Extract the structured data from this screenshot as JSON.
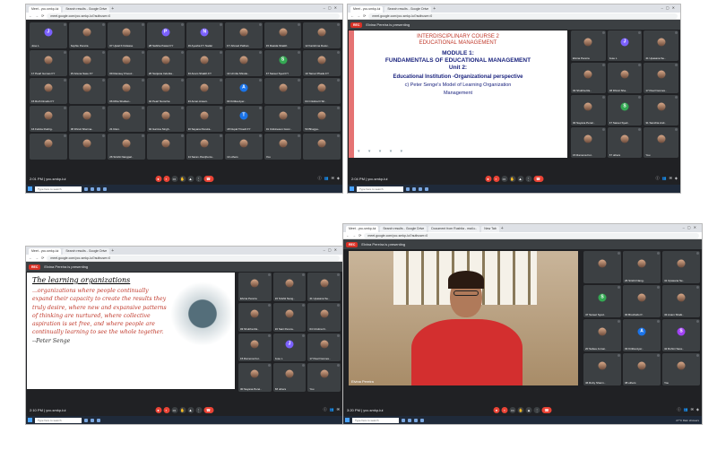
{
  "shot1": {
    "tabs": [
      "Meet - ycc-smkp-lui",
      "Search results - Google Drive"
    ],
    "url": "meet.google.com/ycc-smkp-lui?authuser=0",
    "participants": [
      {
        "name": "Jose L",
        "initial": "J",
        "color": "#7b61ff"
      },
      {
        "name": "Sophie Pereira",
        "initial": "",
        "color": ""
      },
      {
        "name": "07 Ujwal K Dolasse",
        "initial": "",
        "color": ""
      },
      {
        "name": "28 Sabiha Pawar FY",
        "initial": "P",
        "color": "#7b61ff"
      },
      {
        "name": "29 Ayesha FY Nadar",
        "initial": "N",
        "color": "#7b61ff"
      },
      {
        "name": "FY Ahmed Pathan",
        "initial": "",
        "color": ""
      },
      {
        "name": "15 Rasida Shaikh",
        "initial": "",
        "color": ""
      },
      {
        "name": "12 Karishma Desiv..",
        "initial": "",
        "color": ""
      },
      {
        "name": "17 Pearl Gomes FY",
        "initial": "",
        "color": ""
      },
      {
        "name": "15 Ariena Saxe FY",
        "initial": "",
        "color": ""
      },
      {
        "name": "09 Ramsey D'souz..",
        "initial": "",
        "color": ""
      },
      {
        "name": "26 Sanjana Indurka..",
        "initial": "",
        "color": ""
      },
      {
        "name": "43 Anam Shaikh FY",
        "initial": "",
        "color": ""
      },
      {
        "name": "14 Urmila Shinde..",
        "initial": "",
        "color": ""
      },
      {
        "name": "47 Sareet Syed FY",
        "initial": "S",
        "color": "#34a853"
      },
      {
        "name": "10 Tamar Phade FY",
        "initial": "",
        "color": ""
      },
      {
        "name": "15 Ruth Dmello FY",
        "initial": "",
        "color": ""
      },
      {
        "name": "",
        "initial": "",
        "color": ""
      },
      {
        "name": "06 Riha Shelken..",
        "initial": "",
        "color": ""
      },
      {
        "name": "42 Pearl Noronha",
        "initial": "",
        "color": ""
      },
      {
        "name": "33 Aman Ansari..",
        "initial": "",
        "color": ""
      },
      {
        "name": "03 Kritika Ayer..",
        "initial": "A",
        "color": "#1a73e8"
      },
      {
        "name": "",
        "initial": "",
        "color": ""
      },
      {
        "name": "04 Cristina D Sil..",
        "initial": "",
        "color": ""
      },
      {
        "name": "16 Felicia Rodrig..",
        "initial": "",
        "color": ""
      },
      {
        "name": "08 Dhruti Sharma..",
        "initial": "",
        "color": ""
      },
      {
        "name": "21 Ravi..",
        "initial": "",
        "color": ""
      },
      {
        "name": "02 Garima Singh..",
        "initial": "",
        "color": ""
      },
      {
        "name": "30 Sayana Pereira..",
        "initial": "",
        "color": ""
      },
      {
        "name": "18 Nupal Trivedi FY",
        "initial": "T",
        "color": "#1a73e8"
      },
      {
        "name": "01 Cidvineson Gonc..",
        "initial": "",
        "color": ""
      },
      {
        "name": "53 Bhagya..",
        "initial": "",
        "color": ""
      },
      {
        "name": "",
        "initial": "",
        "color": ""
      },
      {
        "name": "",
        "initial": "",
        "color": ""
      },
      {
        "name": "26 Srishti Nangpal..",
        "initial": "",
        "color": ""
      },
      {
        "name": "",
        "initial": "",
        "color": ""
      },
      {
        "name": "24 Saran Jhunjhunw..",
        "initial": "",
        "color": ""
      },
      {
        "name": "13 others",
        "initial": "",
        "color": ""
      },
      {
        "name": "You",
        "initial": "",
        "color": ""
      },
      {
        "name": "",
        "initial": "",
        "color": ""
      }
    ],
    "time": "2:01 PM",
    "separator": "|",
    "meeting_code": "ycc-smkp-lui",
    "taskbar_search": "Type here to search"
  },
  "shot2": {
    "tabs": [
      "Meet - ycc-smkp-lui",
      "Search results - Google Drive"
    ],
    "url": "meet.google.com/ycc-smkp-lui?authuser=0",
    "rec": "REC",
    "presenting": "Elvina Pereira is presenting",
    "slide": {
      "course": "INTERDISCIPLINARY COURSE 2",
      "course2": "EDUCATIONAL MANAGEMENT",
      "module": "MODULE 1:",
      "module2": "FUNDAMENTALS OF EDUCATIONAL MANAGEMENT",
      "unit": "Unit 2:",
      "inst": "Educational Institution -Organizational perspective",
      "senge": "c) Peter  Senge's Model  of  Learning  Organization",
      "senge2": "Management"
    },
    "participants": [
      {
        "name": "Elvina Pereira",
        "initial": "",
        "color": ""
      },
      {
        "name": "Jose L",
        "initial": "J",
        "color": "#7b61ff"
      },
      {
        "name": "41 Upasana Se..",
        "initial": "",
        "color": ""
      },
      {
        "name": "03 Shubha Ra..",
        "initial": "",
        "color": ""
      },
      {
        "name": "08 Dhruti Sha..",
        "initial": "",
        "color": ""
      },
      {
        "name": "17 Pearl Gomes..",
        "initial": "",
        "color": ""
      },
      {
        "name": "30 Sayana Pereir..",
        "initial": "",
        "color": ""
      },
      {
        "name": "47 Sareet Syed..",
        "initial": "S",
        "color": "#34a853"
      },
      {
        "name": "31 Sanchia And..",
        "initial": "",
        "color": ""
      },
      {
        "name": "15 Ramona For..",
        "initial": "",
        "color": ""
      },
      {
        "name": "57 others",
        "initial": "",
        "color": ""
      },
      {
        "name": "You",
        "initial": "",
        "color": ""
      }
    ],
    "time": "2:04 PM",
    "separator": "|",
    "meeting_code": "ycc-smkp-lui",
    "taskbar_search": "Type here to search"
  },
  "shot3": {
    "tabs": [
      "Meet - ycc-smkp-lui",
      "Search results - Google Drive"
    ],
    "url": "meet.google.com/ycc-smkp-lui?authuser=0",
    "rec": "REC",
    "presenting": "Elvina Pereira is presenting",
    "slide": {
      "heading_prefix": "The ",
      "heading_underlined": "learning organizations",
      "body": "...organizations where people continually expand their capacity to create the results they truly desire, where new and expansive patterns of thinking are nurtured, where collective aspiration is set free, and where people are continually learning to see the whole together.",
      "quote_by": "--Peter Senge"
    },
    "participants": [
      {
        "name": "Elvina Pereira",
        "initial": "",
        "color": ""
      },
      {
        "name": "26 Srishti Nang..",
        "initial": "",
        "color": ""
      },
      {
        "name": "41 Upasana Se..",
        "initial": "",
        "color": ""
      },
      {
        "name": "03 Shubha Ra..",
        "initial": "",
        "color": ""
      },
      {
        "name": "20 Sani Perera..",
        "initial": "",
        "color": ""
      },
      {
        "name": "04 Cristina D..",
        "initial": "",
        "color": ""
      },
      {
        "name": "15 Ramona For..",
        "initial": "",
        "color": ""
      },
      {
        "name": "Jose L",
        "initial": "J",
        "color": "#7b61ff"
      },
      {
        "name": "17 Pearl Gomes..",
        "initial": "",
        "color": ""
      },
      {
        "name": "30 Sayana Perei..",
        "initial": "",
        "color": ""
      },
      {
        "name": "58 others",
        "initial": "",
        "color": ""
      },
      {
        "name": "You",
        "initial": "",
        "color": ""
      }
    ],
    "time": "2:10 PM",
    "separator": "|",
    "meeting_code": "ycc-smkp-lui",
    "taskbar_search": "Type here to search"
  },
  "shot4": {
    "tabs": [
      "Meet - ycc-smkp-lui",
      "Search results - Google Drive",
      "Document from Rushita - mail.c..",
      "New Tab"
    ],
    "url": "meet.google.com/ycc-smkp-lui?authuser=0",
    "rec": "REC",
    "presenting": "Elvina Pereira is presenting",
    "speaker_name": "Elvina Pereira",
    "participants": [
      {
        "name": "",
        "initial": "",
        "color": ""
      },
      {
        "name": "26 Srishti Nang..",
        "initial": "",
        "color": ""
      },
      {
        "name": "41 Upasana Se..",
        "initial": "",
        "color": ""
      },
      {
        "name": "47 Sareet Syed..",
        "initial": "S",
        "color": "#34a853"
      },
      {
        "name": "30 Bruchello P..",
        "initial": "",
        "color": ""
      },
      {
        "name": "43 Anam Shaik..",
        "initial": "",
        "color": ""
      },
      {
        "name": "20 Sabea Jumai..",
        "initial": "",
        "color": ""
      },
      {
        "name": "03 Kritika Ayer..",
        "initial": "A",
        "color": "#1a73e8"
      },
      {
        "name": "42 Rohini Save..",
        "initial": "S",
        "color": "#a142f4"
      },
      {
        "name": "46 Ruby Sharm..",
        "initial": "",
        "color": ""
      },
      {
        "name": "38 others",
        "initial": "",
        "color": ""
      },
      {
        "name": "You",
        "initial": "",
        "color": ""
      }
    ],
    "time": "3:20 PM",
    "separator": "|",
    "meeting_code": "ycc-smkp-lui",
    "taskbar_search": "Type here to search",
    "weather": "27°C  Rain showers"
  }
}
